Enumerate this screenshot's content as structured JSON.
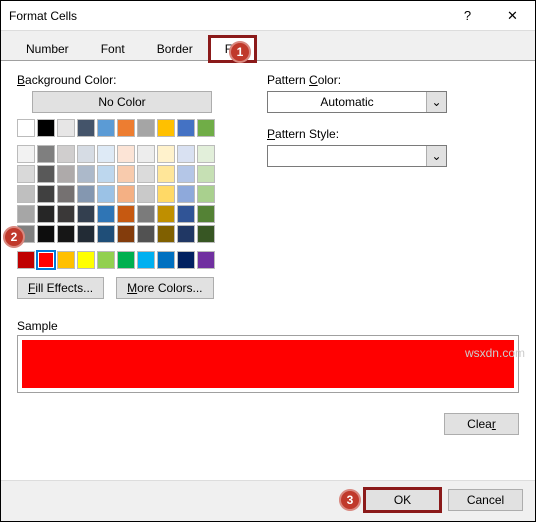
{
  "dialog": {
    "title": "Format Cells"
  },
  "tabs": {
    "number": "Number",
    "font": "Font",
    "border": "Border",
    "fill": "Fill"
  },
  "labels": {
    "bg_color": "Background Color:",
    "no_color": "No Color",
    "pattern_color": "Pattern Color:",
    "pattern_style": "Pattern Style:",
    "sample": "Sample"
  },
  "buttons": {
    "fill_effects": "Fill Effects...",
    "more_colors": "More Colors...",
    "clear": "Clear",
    "ok": "OK",
    "cancel": "Cancel"
  },
  "dropdowns": {
    "pattern_color_value": "Automatic",
    "pattern_style_value": ""
  },
  "callouts": {
    "c1": "1",
    "c2": "2",
    "c3": "3"
  },
  "watermark": "wsxdn.com",
  "selected_color": "#ff0000",
  "palette_top": [
    "#ffffff",
    "#000000",
    "#e7e6e6",
    "#44546a",
    "#5b9bd5",
    "#ed7d31",
    "#a5a5a5",
    "#ffc000",
    "#4472c4",
    "#70ad47"
  ],
  "palette_mid": [
    "#f2f2f2",
    "#7f7f7f",
    "#d0cece",
    "#d6dce4",
    "#deeaf6",
    "#fce4d6",
    "#ededed",
    "#fff2cc",
    "#d9e1f2",
    "#e2efda",
    "#d9d9d9",
    "#595959",
    "#aeaaaa",
    "#acb9ca",
    "#bdd7ee",
    "#f8cbad",
    "#dbdbdb",
    "#ffe699",
    "#b4c6e7",
    "#c6e0b4",
    "#bfbfbf",
    "#404040",
    "#757171",
    "#8497b0",
    "#9bc2e6",
    "#f4b084",
    "#c9c9c9",
    "#ffd966",
    "#8ea9db",
    "#a9d08e",
    "#a6a6a6",
    "#262626",
    "#3a3838",
    "#333f4f",
    "#2f75b5",
    "#c65911",
    "#7b7b7b",
    "#bf8f00",
    "#305496",
    "#548235",
    "#808080",
    "#0d0d0d",
    "#161616",
    "#222b35",
    "#1f4e78",
    "#833c0c",
    "#525252",
    "#806000",
    "#203764",
    "#375623"
  ],
  "palette_std": [
    "#c00000",
    "#ff0000",
    "#ffc000",
    "#ffff00",
    "#92d050",
    "#00b050",
    "#00b0f0",
    "#0070c0",
    "#002060",
    "#7030a0"
  ]
}
